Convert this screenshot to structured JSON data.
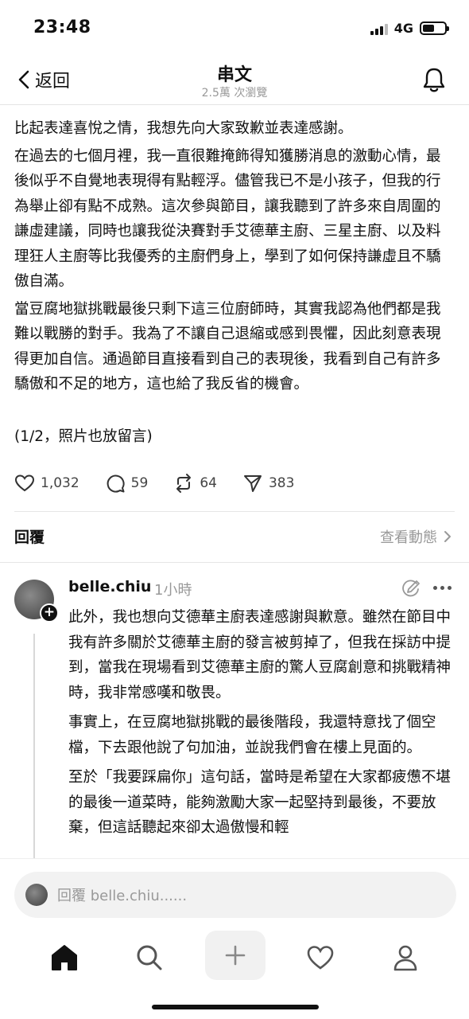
{
  "status_bar": {
    "time": "23:48",
    "network": "4G"
  },
  "nav": {
    "back_label": "返回",
    "title": "串文",
    "subtitle": "2.5萬 次瀏覽"
  },
  "post": {
    "paragraphs": [
      "比起表達喜悅之情，我想先向大家致歉並表達感謝。",
      "在過去的七個月裡，我一直很難掩飾得知獲勝消息的激動心情，最後似乎不自覺地表現得有點輕浮。儘管我已不是小孩子，但我的行為舉止卻有點不成熟。這次參與節目，讓我聽到了許多來自周圍的謙虛建議，同時也讓我從決賽對手艾德華主廚、三星主廚、以及料理狂人主廚等比我優秀的主廚們身上，學到了如何保持謙虛且不驕傲自滿。",
      "當豆腐地獄挑戰最後只剩下這三位廚師時，其實我認為他們都是我難以戰勝的對手。我為了不讓自己退縮或感到畏懼，因此刻意表現得更加自信。通過節目直接看到自己的表現後，我看到自己有許多驕傲和不足的地方，這也給了我反省的機會。",
      "(1/2，照片也放留言)"
    ]
  },
  "actions": {
    "likes": "1,032",
    "comments": "59",
    "reposts": "64",
    "shares": "383"
  },
  "reply_section": {
    "title": "回覆",
    "view_activity": "查看動態"
  },
  "comment": {
    "username": "belle.chiu",
    "time": "1小時",
    "paragraphs": [
      "此外，我也想向艾德華主廚表達感謝與歉意。雖然在節目中我有許多關於艾德華主廚的發言被剪掉了，但我在採訪中提到，當我在現場看到艾德華主廚的驚人豆腐創意和挑戰精神時，我非常感嘆和敬畏。",
      "事實上，在豆腐地獄挑戰的最後階段，我還特意找了個空檔，下去跟他說了句加油，並說我們會在樓上見面的。",
      "至於「我要踩扁你」這句話，當時是希望在大家都疲憊不堪的最後一道菜時，能夠激勵大家一起堅持到最後，不要放棄，但這話聽起來卻太過傲慢和輕"
    ]
  },
  "reply_input": {
    "placeholder": "回覆 belle.chiu......"
  },
  "icons": {
    "back": "chevron-left-icon",
    "bell": "bell-icon",
    "heart": "heart-icon",
    "comment": "comment-bubble-icon",
    "repost": "repost-icon",
    "send": "send-icon",
    "home": "home-icon",
    "search": "search-icon",
    "compose": "plus-icon",
    "activity": "heart-icon",
    "profile": "person-icon"
  }
}
